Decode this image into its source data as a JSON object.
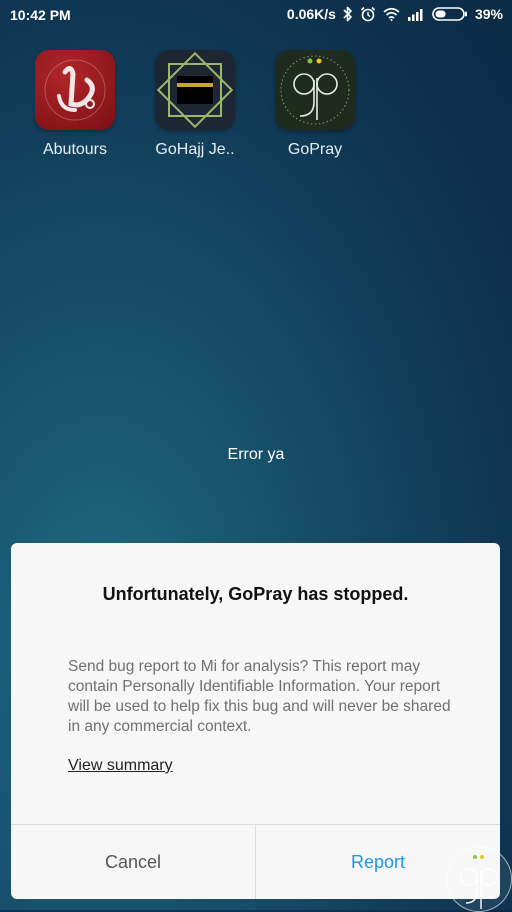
{
  "status_bar": {
    "time": "10:42 PM",
    "network_speed": "0.06K/s",
    "battery_percent": "39%",
    "battery_level": 0.39,
    "icons": [
      "bluetooth-icon",
      "alarm-icon",
      "wifi-icon",
      "signal-icon",
      "battery-icon"
    ]
  },
  "home": {
    "apps": [
      {
        "label": "Abutours",
        "icon": "abutours-logo-icon"
      },
      {
        "label": "GoHajj Je..",
        "icon": "kaaba-icon"
      },
      {
        "label": "GoPray",
        "icon": "gopray-logo-icon"
      }
    ]
  },
  "toast": {
    "text": "Error ya"
  },
  "dialog": {
    "title": "Unfortunately, GoPray has stopped.",
    "message": "Send bug report to Mi for analysis? This report may contain Personally Identifiable Information. Your report will be used to help fix this bug and will never be shared in any commercial context.",
    "link": "View summary",
    "cancel_label": "Cancel",
    "report_label": "Report"
  },
  "colors": {
    "accent": "#2196e8",
    "dialog_bg": "#f7f7f7",
    "wallpaper": "#174f6a"
  }
}
